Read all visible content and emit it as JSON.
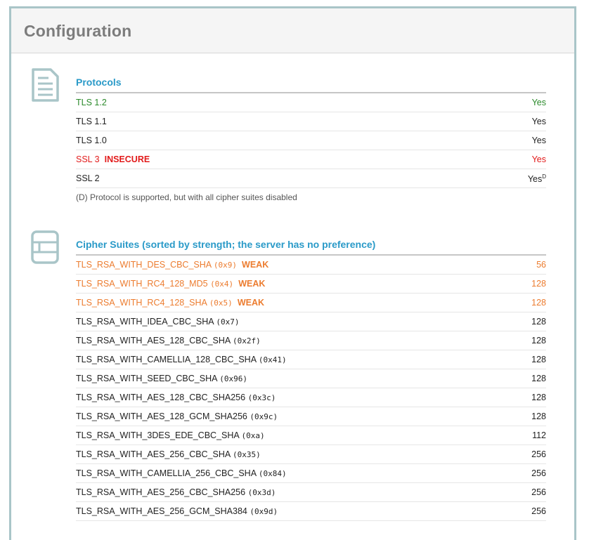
{
  "header": {
    "title": "Configuration"
  },
  "protocols": {
    "title": "Protocols",
    "icon": "document-icon",
    "rows": [
      {
        "name": "TLS 1.2",
        "value": "Yes",
        "status": "good",
        "flag": "",
        "sup": ""
      },
      {
        "name": "TLS 1.1",
        "value": "Yes",
        "status": "normal",
        "flag": "",
        "sup": ""
      },
      {
        "name": "TLS 1.0",
        "value": "Yes",
        "status": "normal",
        "flag": "",
        "sup": ""
      },
      {
        "name": "SSL 3",
        "value": "Yes",
        "status": "bad",
        "flag": "INSECURE",
        "sup": ""
      },
      {
        "name": "SSL 2",
        "value": "Yes",
        "status": "normal",
        "flag": "",
        "sup": "D"
      }
    ],
    "note": "(D) Protocol is supported, but with all cipher suites disabled"
  },
  "ciphers": {
    "title": "Cipher Suites (sorted by strength; the server has no preference)",
    "icon": "cipher-suites-icon",
    "rows": [
      {
        "name": "TLS_RSA_WITH_DES_CBC_SHA",
        "code": "(0x9)",
        "flag": "WEAK",
        "value": "56",
        "weak": true
      },
      {
        "name": "TLS_RSA_WITH_RC4_128_MD5",
        "code": "(0x4)",
        "flag": "WEAK",
        "value": "128",
        "weak": true
      },
      {
        "name": "TLS_RSA_WITH_RC4_128_SHA",
        "code": "(0x5)",
        "flag": "WEAK",
        "value": "128",
        "weak": true
      },
      {
        "name": "TLS_RSA_WITH_IDEA_CBC_SHA",
        "code": "(0x7)",
        "flag": "",
        "value": "128",
        "weak": false
      },
      {
        "name": "TLS_RSA_WITH_AES_128_CBC_SHA",
        "code": "(0x2f)",
        "flag": "",
        "value": "128",
        "weak": false
      },
      {
        "name": "TLS_RSA_WITH_CAMELLIA_128_CBC_SHA",
        "code": "(0x41)",
        "flag": "",
        "value": "128",
        "weak": false
      },
      {
        "name": "TLS_RSA_WITH_SEED_CBC_SHA",
        "code": "(0x96)",
        "flag": "",
        "value": "128",
        "weak": false
      },
      {
        "name": "TLS_RSA_WITH_AES_128_CBC_SHA256",
        "code": "(0x3c)",
        "flag": "",
        "value": "128",
        "weak": false
      },
      {
        "name": "TLS_RSA_WITH_AES_128_GCM_SHA256",
        "code": "(0x9c)",
        "flag": "",
        "value": "128",
        "weak": false
      },
      {
        "name": "TLS_RSA_WITH_3DES_EDE_CBC_SHA",
        "code": "(0xa)",
        "flag": "",
        "value": "112",
        "weak": false
      },
      {
        "name": "TLS_RSA_WITH_AES_256_CBC_SHA",
        "code": "(0x35)",
        "flag": "",
        "value": "256",
        "weak": false
      },
      {
        "name": "TLS_RSA_WITH_CAMELLIA_256_CBC_SHA",
        "code": "(0x84)",
        "flag": "",
        "value": "256",
        "weak": false
      },
      {
        "name": "TLS_RSA_WITH_AES_256_CBC_SHA256",
        "code": "(0x3d)",
        "flag": "",
        "value": "256",
        "weak": false
      },
      {
        "name": "TLS_RSA_WITH_AES_256_GCM_SHA384",
        "code": "(0x9d)",
        "flag": "",
        "value": "256",
        "weak": false
      }
    ]
  },
  "colors": {
    "accent": "#2a9ac8",
    "good": "#2b8a2b",
    "bad": "#e21b1b",
    "weak": "#ec7c2f",
    "frame": "#a9c5c8"
  }
}
